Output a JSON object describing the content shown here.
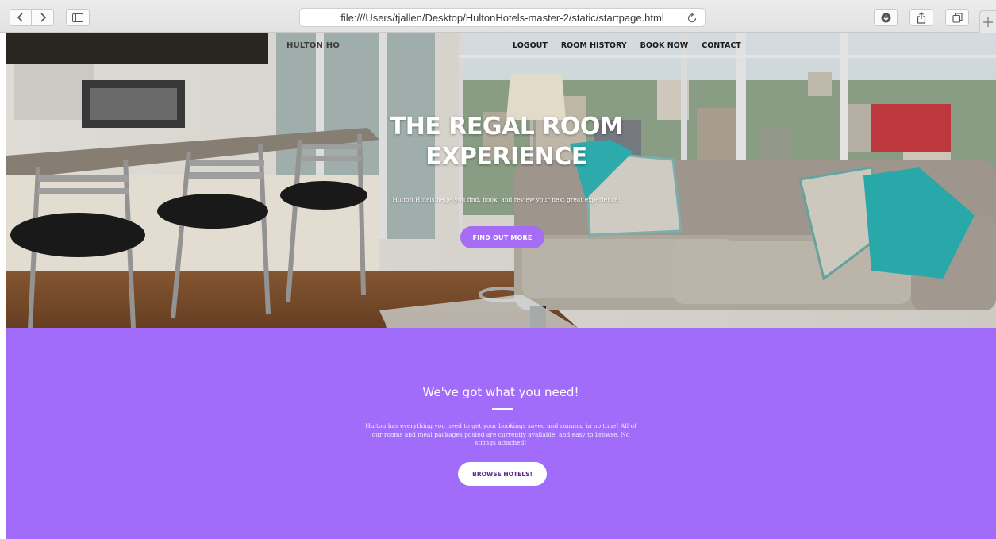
{
  "browser": {
    "url": "file:///Users/tjallen/Desktop/HultonHotels-master-2/static/startpage.html",
    "icons": [
      "back-icon",
      "forward-icon",
      "sidebar-icon",
      "reload-icon",
      "download-icon",
      "share-icon",
      "tabs-icon",
      "new-tab-icon"
    ]
  },
  "header": {
    "brand": "HULTON HO",
    "nav": [
      {
        "label": "LOGOUT"
      },
      {
        "label": "ROOM HISTORY"
      },
      {
        "label": "BOOK NOW"
      },
      {
        "label": "CONTACT"
      }
    ]
  },
  "hero": {
    "title_line1": "THE REGAL ROOM",
    "title_line2": "EXPERIENCE",
    "subtitle": "Hulton Hotels helps you find, book, and review your next great experience!",
    "button_label": "FIND OUT MORE"
  },
  "feature": {
    "title": "We've got what you need!",
    "text": "Hulton has everything you need to get your bookings saved and running in no time! All of our rooms and meal packages posted are currently available, and easy to browse. No strings attached!",
    "button_label": "BROWSE HOTELS!"
  },
  "colors": {
    "accent": "#a66cf5",
    "feature_bg": "#a26cfb"
  }
}
